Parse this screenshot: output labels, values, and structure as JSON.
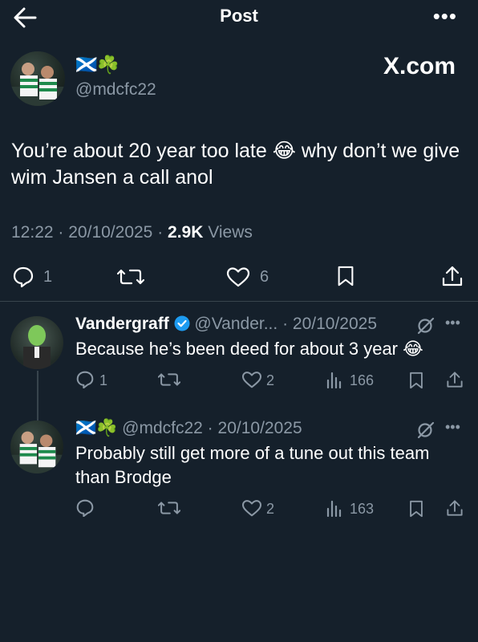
{
  "header": {
    "title": "Post",
    "more": "•••"
  },
  "main_post": {
    "flags": "🏴󠁧󠁢󠁳󠁣󠁴󠁿☘️",
    "handle": "@mdcfc22",
    "watermark": "X.com",
    "text": "You’re about 20 year too late 😂 why don’t we give wim Jansen a call anol",
    "time": "12:22",
    "date": "20/10/2025",
    "views_count": "2.9K",
    "views_label": "Views",
    "reply_count": "1",
    "like_count": "6"
  },
  "replies": [
    {
      "name": "Vandergraff",
      "handle": "@Vander...",
      "date": "20/10/2025",
      "text": "Because he’s been deed for about 3 year 😂",
      "reply_count": "1",
      "like_count": "2",
      "view_count": "166"
    },
    {
      "flags": "🏴󠁧󠁢󠁳󠁣󠁴󠁿☘️",
      "handle": "@mdcfc22",
      "date": "20/10/2025",
      "text": "Probably still get more of a tune out this team than Brodge",
      "like_count": "2",
      "view_count": "163"
    }
  ],
  "separator": "·",
  "colors": {
    "background": "#15202b",
    "muted": "#8b98a5",
    "verified": "#1d9bf0"
  }
}
